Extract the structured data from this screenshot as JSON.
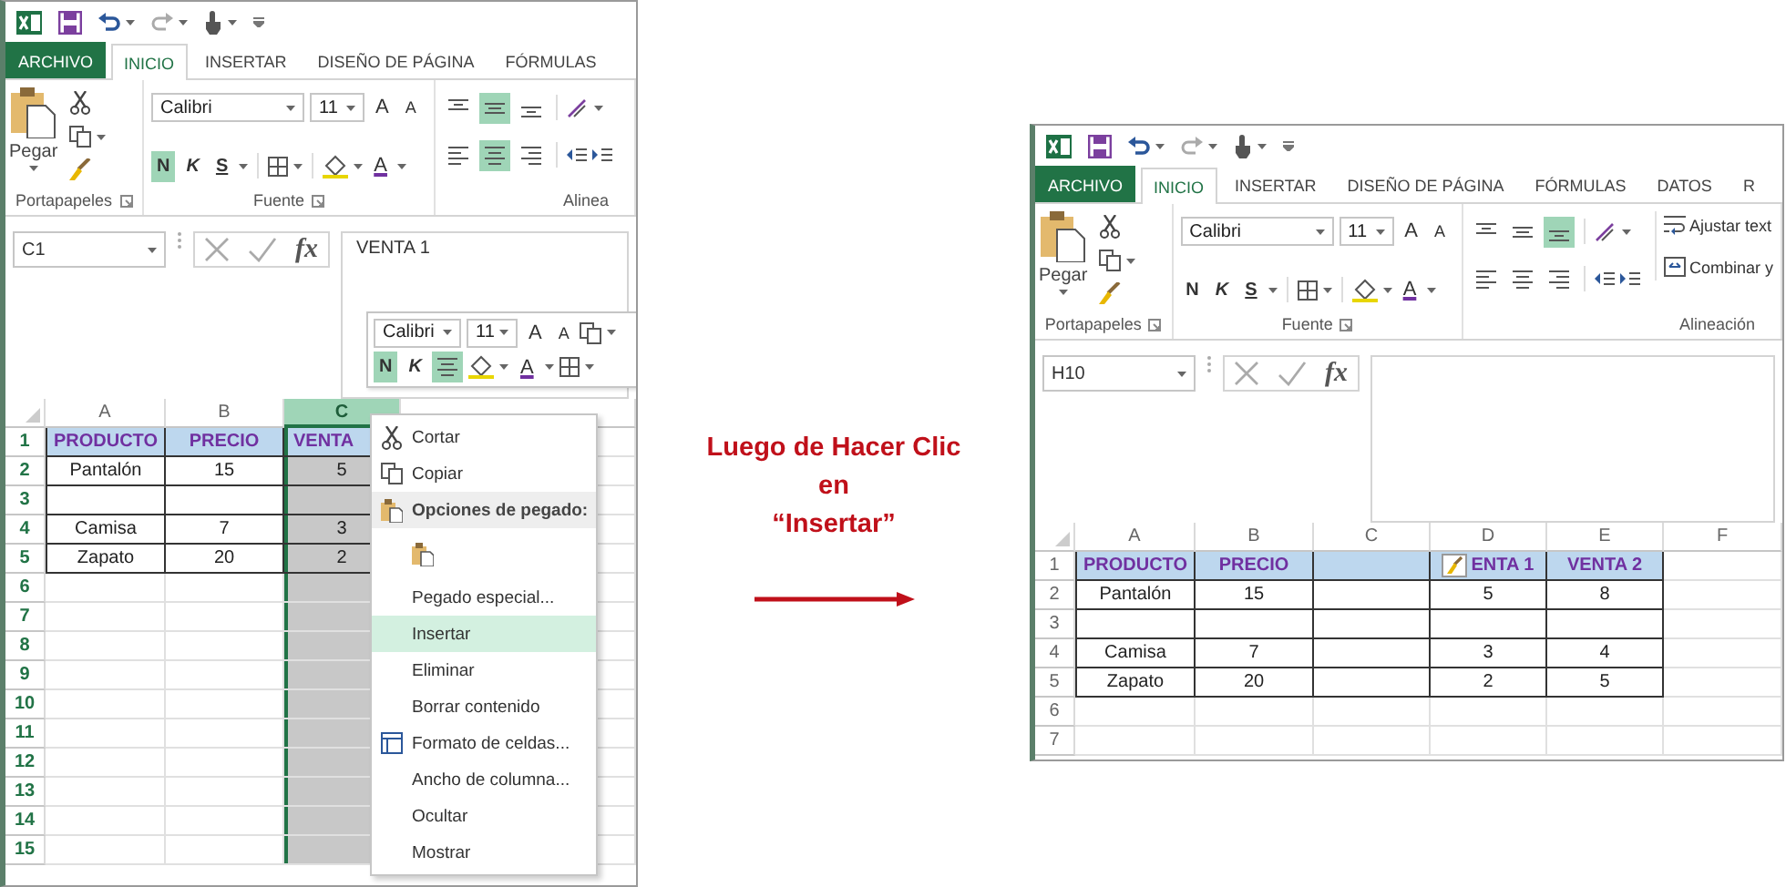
{
  "left_window": {
    "tabs": [
      {
        "label": "ARCHIVO",
        "kind": "file",
        "selected": false
      },
      {
        "label": "INICIO",
        "kind": "tab",
        "selected": true
      },
      {
        "label": "INSERTAR",
        "kind": "tab",
        "selected": false
      },
      {
        "label": "DISEÑO DE PÁGINA",
        "kind": "tab",
        "selected": false
      },
      {
        "label": "FÓRMULAS",
        "kind": "tab",
        "selected": false
      }
    ],
    "ribbon": {
      "paste_label": "Pegar",
      "font_name": "Calibri",
      "font_size": "11",
      "grow_font": "A",
      "shrink_font": "A",
      "font_color": "A",
      "bold": {
        "label": "N",
        "on": true
      },
      "italic": {
        "label": "K",
        "on": false
      },
      "underline": {
        "label": "S",
        "on": false
      },
      "vertical_alignment": [
        {
          "selected": false
        },
        {
          "selected": true
        },
        {
          "selected": false
        }
      ],
      "horizontal_alignment": [
        {
          "selected": false
        },
        {
          "selected": true
        },
        {
          "selected": false
        }
      ],
      "groups": [
        "Portapapeles",
        "Fuente",
        "Alinea"
      ]
    },
    "name_box": "C1",
    "function_label": "fx",
    "formula": "VENTA 1",
    "mini_toolbar": {
      "font_name": "Calibri",
      "font_size": "11",
      "grow_font": "A",
      "shrink_font": "A",
      "font_color": "A",
      "bold": {
        "label": "N",
        "on": true
      },
      "italic": {
        "label": "K",
        "on": false
      },
      "center": {
        "on": true
      }
    },
    "columns": [
      {
        "label": "A",
        "selected": false
      },
      {
        "label": "B",
        "selected": false
      },
      {
        "label": "C",
        "selected": true
      }
    ],
    "rows": [
      {
        "number": "1",
        "kind": "header",
        "cells": [
          "PRODUCTO",
          "PRECIO",
          "VENTA"
        ]
      },
      {
        "number": "2",
        "kind": "data",
        "cells": [
          "Pantalón",
          "15",
          "5"
        ]
      },
      {
        "number": "3",
        "kind": "data",
        "cells": [
          null,
          null,
          null
        ]
      },
      {
        "number": "4",
        "kind": "data",
        "cells": [
          "Camisa",
          "7",
          "3"
        ]
      },
      {
        "number": "5",
        "kind": "data",
        "cells": [
          "Zapato",
          "20",
          "2"
        ]
      },
      {
        "number": "6"
      },
      {
        "number": "7"
      },
      {
        "number": "8"
      },
      {
        "number": "9"
      },
      {
        "number": "10"
      },
      {
        "number": "11"
      },
      {
        "number": "12"
      },
      {
        "number": "13"
      },
      {
        "number": "14"
      },
      {
        "number": "15"
      }
    ],
    "context_menu": [
      {
        "label": "Cortar",
        "kind": "cut",
        "selected": false
      },
      {
        "label": "Copiar",
        "kind": "copy",
        "selected": false
      },
      {
        "label": "Opciones de pegado:",
        "kind": "heading",
        "selected": false
      },
      {
        "kind": "paste",
        "selected": false
      },
      {
        "label": "Pegado especial...",
        "kind": "plain",
        "selected": false
      },
      {
        "label": "Insertar",
        "kind": "plain",
        "selected": true
      },
      {
        "label": "Eliminar",
        "kind": "plain",
        "selected": false
      },
      {
        "label": "Borrar contenido",
        "kind": "plain",
        "selected": false
      },
      {
        "label": "Formato de celdas...",
        "kind": "format",
        "selected": false
      },
      {
        "label": "Ancho de columna...",
        "kind": "plain",
        "selected": false
      },
      {
        "label": "Ocultar",
        "kind": "plain",
        "selected": false
      },
      {
        "label": "Mostrar",
        "kind": "plain",
        "selected": false
      }
    ]
  },
  "caption": {
    "lines": [
      "Luego de Hacer Clic",
      "en",
      "“Insertar”"
    ]
  },
  "right_window": {
    "tabs": [
      {
        "label": "ARCHIVO",
        "kind": "file",
        "selected": false
      },
      {
        "label": "INICIO",
        "kind": "tab",
        "selected": true
      },
      {
        "label": "INSERTAR",
        "kind": "tab",
        "selected": false
      },
      {
        "label": "DISEÑO DE PÁGINA",
        "kind": "tab",
        "selected": false
      },
      {
        "label": "FÓRMULAS",
        "kind": "tab",
        "selected": false
      },
      {
        "label": "DATOS",
        "kind": "tab",
        "selected": false
      },
      {
        "label": "R",
        "kind": "tab",
        "selected": false
      }
    ],
    "ribbon": {
      "paste_label": "Pegar",
      "font_name": "Calibri",
      "font_size": "11",
      "grow_font": "A",
      "shrink_font": "A",
      "font_color": "A",
      "bold": {
        "label": "N",
        "on": false
      },
      "italic": {
        "label": "K",
        "on": false
      },
      "underline": {
        "label": "S",
        "on": false
      },
      "vertical_alignment": [
        {
          "selected": false
        },
        {
          "selected": false
        },
        {
          "selected": true
        }
      ],
      "horizontal_alignment": [
        {
          "selected": false
        },
        {
          "selected": false
        },
        {
          "selected": false
        }
      ],
      "wrap_buttons": [
        "Ajustar text",
        "Combinar y"
      ],
      "groups": [
        "Portapapeles",
        "Fuente",
        "Alineación"
      ]
    },
    "name_box": "H10",
    "function_label": "fx",
    "columns": [
      {
        "label": "A",
        "selected": false
      },
      {
        "label": "B",
        "selected": false
      },
      {
        "label": "C",
        "selected": false
      },
      {
        "label": "D",
        "selected": false
      },
      {
        "label": "E",
        "selected": false
      },
      {
        "label": "F",
        "selected": false
      }
    ],
    "rows": [
      {
        "number": "1",
        "kind": "header",
        "cells": [
          "PRODUCTO",
          "PRECIO",
          null,
          {
            "kind": "insert-options",
            "text": "ENTA 1"
          },
          "VENTA 2"
        ]
      },
      {
        "number": "2",
        "kind": "data",
        "cells": [
          "Pantalón",
          "15",
          null,
          "5",
          "8"
        ]
      },
      {
        "number": "3",
        "kind": "data",
        "cells": [
          null,
          null,
          null,
          null,
          null
        ]
      },
      {
        "number": "4",
        "kind": "data",
        "cells": [
          "Camisa",
          "7",
          null,
          "3",
          "4"
        ]
      },
      {
        "number": "5",
        "kind": "data",
        "cells": [
          "Zapato",
          "20",
          null,
          "2",
          "5"
        ]
      },
      {
        "number": "6"
      },
      {
        "number": "7"
      }
    ]
  }
}
